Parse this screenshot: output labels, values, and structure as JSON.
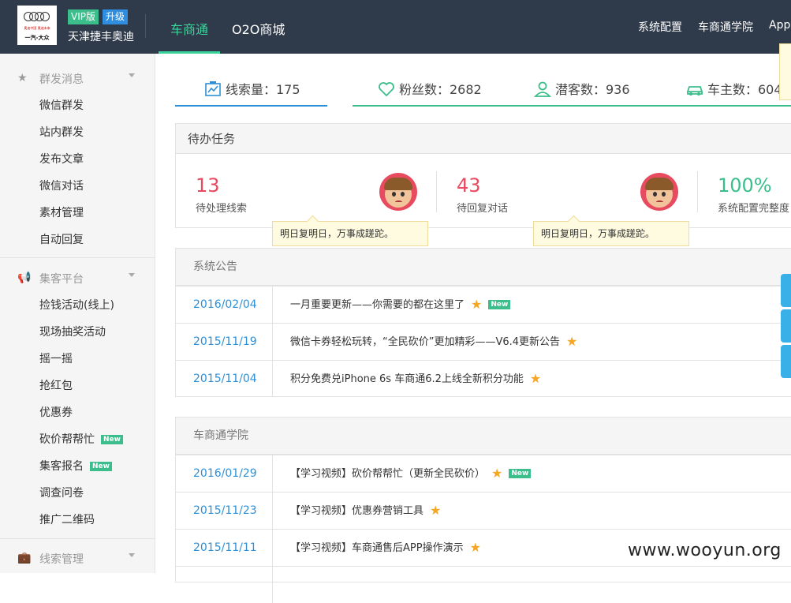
{
  "header": {
    "dealer_name": "天津捷丰奥迪",
    "vip_badge": "VIP版",
    "upgrade_badge": "升级",
    "logo_subtitle": "奥迪中国 奥迪未来",
    "logo_brand": "一汽-大众",
    "nav": [
      "车商通",
      "O2O商城"
    ],
    "right_nav": [
      "系统配置",
      "车商通学院",
      "App"
    ]
  },
  "sidebar": {
    "groups": [
      {
        "label": "群发消息",
        "icon": "star-icon",
        "items": [
          "微信群发",
          "站内群发",
          "发布文章",
          "微信对话",
          "素材管理",
          "自动回复"
        ]
      },
      {
        "label": "集客平台",
        "icon": "megaphone-icon",
        "items": [
          "捡钱活动(线上)",
          "现场抽奖活动",
          "摇一摇",
          "抢红包",
          "优惠券",
          "砍价帮帮忙",
          "集客报名",
          "调查问卷",
          "推广二维码"
        ]
      },
      {
        "label": "线索管理",
        "icon": "briefcase-icon",
        "items": []
      }
    ],
    "new_label": "New"
  },
  "stats": [
    {
      "label": "线索量：175",
      "icon": "chart-icon",
      "color": "#2e8fd6"
    },
    {
      "label": "粉丝数：2682",
      "icon": "heart-icon",
      "color": "#3cbe8c"
    },
    {
      "label": "潜客数：936",
      "icon": "user-icon",
      "color": "#3cbe8c"
    },
    {
      "label": "车主数：604",
      "icon": "car-icon",
      "color": "#3cbe8c"
    }
  ],
  "todo": {
    "title": "待办任务",
    "items": [
      {
        "value": "13",
        "label": "待处理线索",
        "color": "#e84a5f"
      },
      {
        "value": "43",
        "label": "待回复对话",
        "color": "#e84a5f"
      },
      {
        "value": "100%",
        "label": "系统配置完整度",
        "color": "#3cbe8c"
      }
    ],
    "tip": "明日复明日，万事成蹉跎。"
  },
  "notices": {
    "title": "系统公告",
    "rows": [
      {
        "date": "2016/02/04",
        "title": "一月重要更新——你需要的都在这里了",
        "new": true
      },
      {
        "date": "2015/11/19",
        "title": "微信卡券轻松玩转，“全民砍价”更加精彩——V6.4更新公告",
        "new": false
      },
      {
        "date": "2015/11/04",
        "title": "积分免费兑iPhone 6s 车商通6.2上线全新积分功能",
        "new": false
      }
    ]
  },
  "academy": {
    "title": "车商通学院",
    "rows": [
      {
        "date": "2016/01/29",
        "title": "【学习视频】砍价帮帮忙（更新全民砍价）",
        "new": true
      },
      {
        "date": "2015/11/23",
        "title": "【学习视频】优惠券营销工具",
        "new": false
      },
      {
        "date": "2015/11/11",
        "title": "【学习视频】车商通售后APP操作演示",
        "new": false
      }
    ]
  },
  "watermark": "www.wooyun.org"
}
